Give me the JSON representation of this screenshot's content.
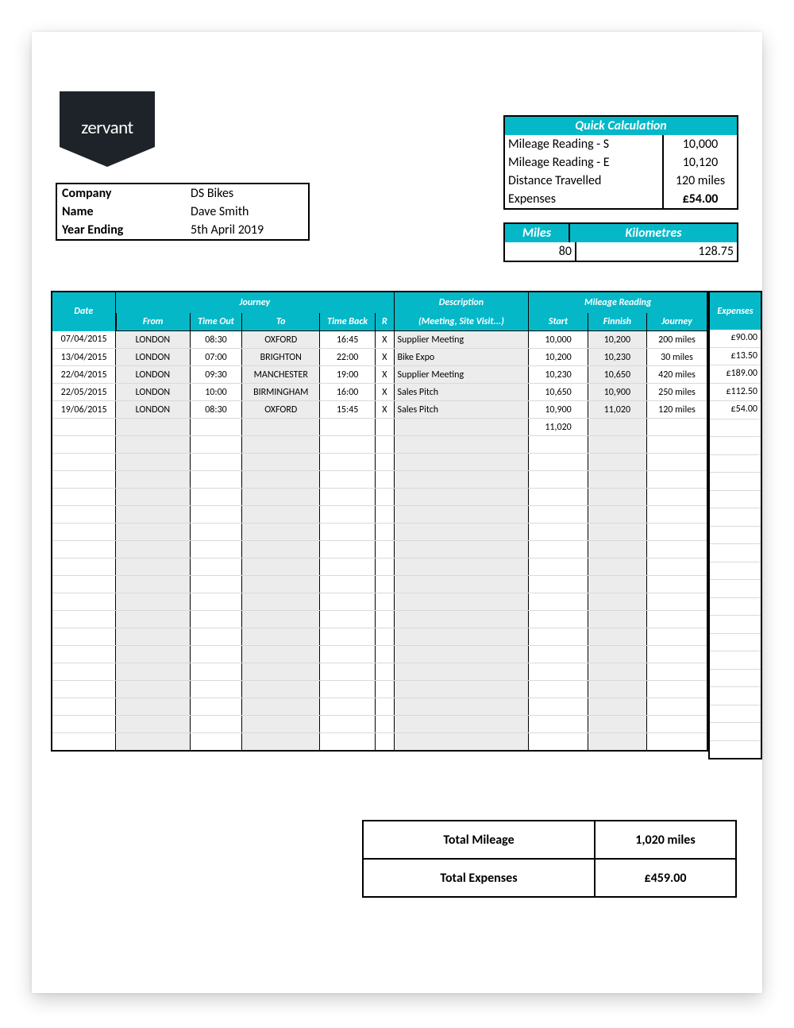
{
  "logo_text": "zervant",
  "company": {
    "labels": {
      "company": "Company",
      "name": "Name",
      "year_ending": "Year Ending"
    },
    "values": {
      "company": "DS Bikes",
      "name": "Dave Smith",
      "year_ending": "5th April 2019"
    }
  },
  "quick": {
    "title": "Quick Calculation",
    "rows": {
      "mr_start_label": "Mileage Reading - S",
      "mr_start_value": "10,000",
      "mr_end_label": "Mileage Reading - E",
      "mr_end_value": "10,120",
      "dist_label": "Distance Travelled",
      "dist_value": "120 miles",
      "exp_label": "Expenses",
      "exp_value": "£54.00"
    }
  },
  "units": {
    "miles_label": "Miles",
    "km_label": "Kilometres",
    "miles_value": "80",
    "km_value": "128.75"
  },
  "headers": {
    "date": "Date",
    "journey": "Journey",
    "from": "From",
    "time_out": "Time Out",
    "to": "To",
    "time_back": "Time Back",
    "r": "R",
    "description": "Description",
    "desc_sub": "(Meeting, Site Visit...)",
    "mileage": "Mileage Reading",
    "start": "Start",
    "finnish": "Finnish",
    "journey_col": "Journey",
    "expenses": "Expenses"
  },
  "rows": [
    {
      "date": "07/04/2015",
      "from": "LONDON",
      "time_out": "08:30",
      "to": "OXFORD",
      "time_back": "16:45",
      "r": "X",
      "desc": "Supplier Meeting",
      "start": "10,000",
      "finish": "10,200",
      "journey": "200 miles",
      "exp": "£90.00"
    },
    {
      "date": "13/04/2015",
      "from": "LONDON",
      "time_out": "07:00",
      "to": "BRIGHTON",
      "time_back": "22:00",
      "r": "X",
      "desc": "Bike Expo",
      "start": "10,200",
      "finish": "10,230",
      "journey": "30 miles",
      "exp": "£13.50"
    },
    {
      "date": "22/04/2015",
      "from": "LONDON",
      "time_out": "09:30",
      "to": "MANCHESTER",
      "time_back": "19:00",
      "r": "X",
      "desc": "Supplier Meeting",
      "start": "10,230",
      "finish": "10,650",
      "journey": "420 miles",
      "exp": "£189.00"
    },
    {
      "date": "22/05/2015",
      "from": "LONDON",
      "time_out": "10:00",
      "to": "BIRMINGHAM",
      "time_back": "16:00",
      "r": "X",
      "desc": "Sales Pitch",
      "start": "10,650",
      "finish": "10,900",
      "journey": "250 miles",
      "exp": "£112.50"
    },
    {
      "date": "19/06/2015",
      "from": "LONDON",
      "time_out": "08:30",
      "to": "OXFORD",
      "time_back": "15:45",
      "r": "X",
      "desc": "Sales Pitch",
      "start": "10,900",
      "finish": "11,020",
      "journey": "120 miles",
      "exp": "£54.00"
    }
  ],
  "extra_start": "11,020",
  "empty_rows": 18,
  "totals": {
    "mileage_label": "Total Mileage",
    "mileage_value": "1,020 miles",
    "expenses_label": "Total Expenses",
    "expenses_value": "£459.00"
  }
}
